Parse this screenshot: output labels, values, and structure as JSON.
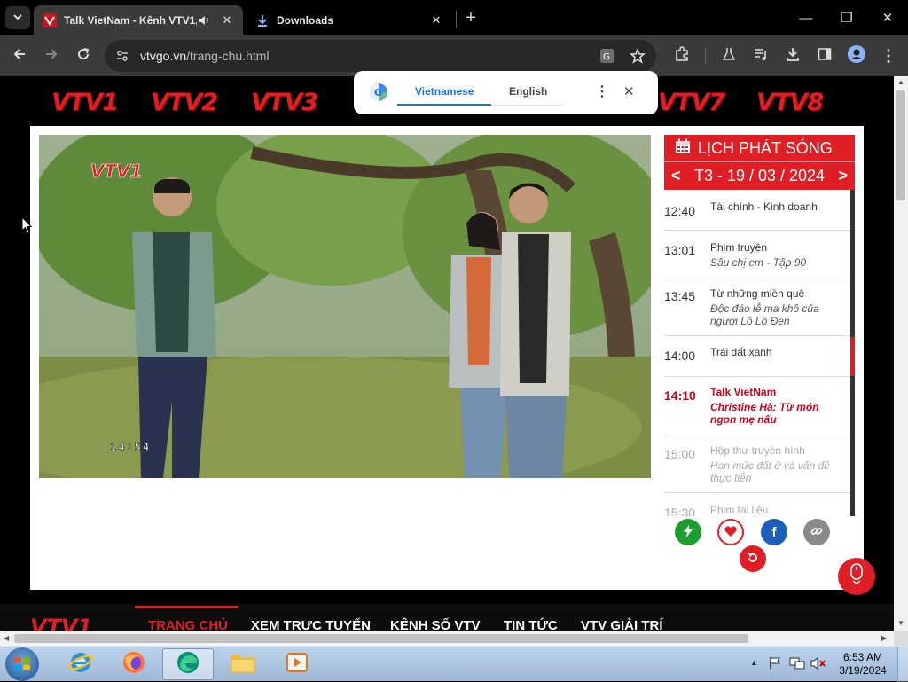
{
  "browser": {
    "tabs": [
      {
        "title": "Talk VietNam - Kênh VTV1,",
        "active": true
      },
      {
        "title": "Downloads",
        "active": false
      }
    ],
    "url_host": "vtvgo.vn",
    "url_path": "/trang-chu.html"
  },
  "translate_popup": {
    "source_lang": "Vietnamese",
    "target_lang": "English"
  },
  "channels": [
    "VTV1",
    "VTV2",
    "VTV3",
    "VTV7",
    "VTV8"
  ],
  "video": {
    "timestamp": "14:54",
    "watermark": "VTV1"
  },
  "schedule": {
    "heading": "LỊCH PHÁT SÓNG",
    "prev": "<",
    "next": ">",
    "date": "T3 - 19 / 03 / 2024",
    "items": [
      {
        "time": "12:40",
        "title": "Tài chính - Kinh doanh",
        "subtitle": "",
        "state": "past"
      },
      {
        "time": "13:01",
        "title": "Phim truyện",
        "subtitle": "Sâu chị em - Tập 90",
        "state": "past"
      },
      {
        "time": "13:45",
        "title": "Từ những miền quê",
        "subtitle": "Độc đáo lễ ma khô của người Lô Lô Đen",
        "state": "past"
      },
      {
        "time": "14:00",
        "title": "Trái đất xanh",
        "subtitle": "",
        "state": "past"
      },
      {
        "time": "14:10",
        "title": "Talk VietNam",
        "subtitle": "Christine Hà: Từ món ngon mẹ nấu",
        "state": "live"
      },
      {
        "time": "15:00",
        "title": "Hộp thư truyền hình",
        "subtitle": "Hạn mức đất ở và vấn đề thực tiễn",
        "state": "future"
      },
      {
        "time": "15:30",
        "title": "Phim tài liệu",
        "subtitle": "",
        "state": "future"
      }
    ]
  },
  "bottom_nav": {
    "items": [
      "TRANG CHỦ",
      "XEM TRỰC TUYẾN",
      "KÊNH SỐ VTV",
      "TIN TỨC",
      "VTV GIẢI TRÍ"
    ]
  },
  "taskbar": {
    "time": "6:53 AM",
    "date": "3/19/2024"
  },
  "colors": {
    "vtv_red": "#e01e25",
    "live_red": "#d0021b",
    "browser_dark": "#3b3b3b",
    "translate_blue": "#1a73e8"
  }
}
